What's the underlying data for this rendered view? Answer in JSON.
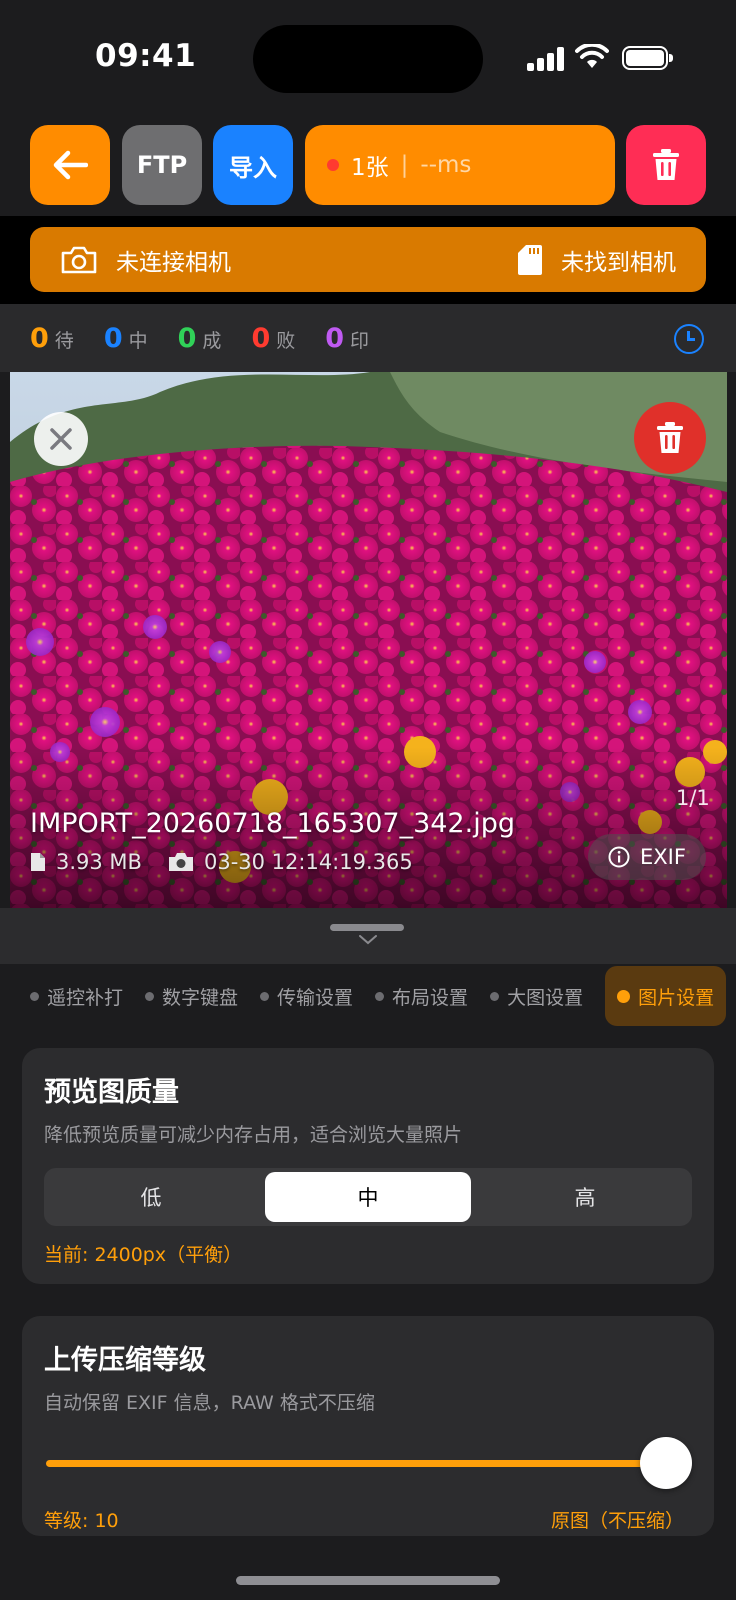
{
  "status_bar": {
    "time": "09:41"
  },
  "toolbar": {
    "ftp_label": "FTP",
    "import_label": "导入",
    "count_label": "1张",
    "separator": "|",
    "latency_label": "--ms",
    "colors": {
      "orange": "#ff8c00",
      "gray": "#6e6e70",
      "blue": "#1a82ff",
      "red": "#ff2d55"
    }
  },
  "camera": {
    "connection_text": "未连接相机",
    "camera_found_text": "未找到相机"
  },
  "counters": [
    {
      "value": "0",
      "label": "待",
      "color": "#ff9f0a"
    },
    {
      "value": "0",
      "label": "中",
      "color": "#1a82ff"
    },
    {
      "value": "0",
      "label": "成",
      "color": "#30d158"
    },
    {
      "value": "0",
      "label": "败",
      "color": "#ff3b30"
    },
    {
      "value": "0",
      "label": "印",
      "color": "#bf5af2"
    }
  ],
  "photo": {
    "position_text": "1/1",
    "filename": "IMPORT_20260718_165307_342.jpg",
    "file_size": "3.93 MB",
    "capture_time": "03-30 12:14:19.365",
    "exif_label": "EXIF"
  },
  "tabs": [
    {
      "label": "遥控补打"
    },
    {
      "label": "数字键盘"
    },
    {
      "label": "传输设置"
    },
    {
      "label": "布局设置"
    },
    {
      "label": "大图设置"
    },
    {
      "label": "图片设置",
      "active": true
    }
  ],
  "preview_quality": {
    "title": "预览图质量",
    "description": "降低预览质量可减少内存占用，适合浏览大量照片",
    "options": [
      "低",
      "中",
      "高"
    ],
    "selected": "中",
    "current_note": "当前: 2400px（平衡）"
  },
  "upload_compression": {
    "title": "上传压缩等级",
    "description": "自动保留 EXIF 信息，RAW 格式不压缩",
    "level_label": "等级: 10",
    "level_value": 10,
    "level_max": 10,
    "level_desc": "原图（不压缩）"
  }
}
